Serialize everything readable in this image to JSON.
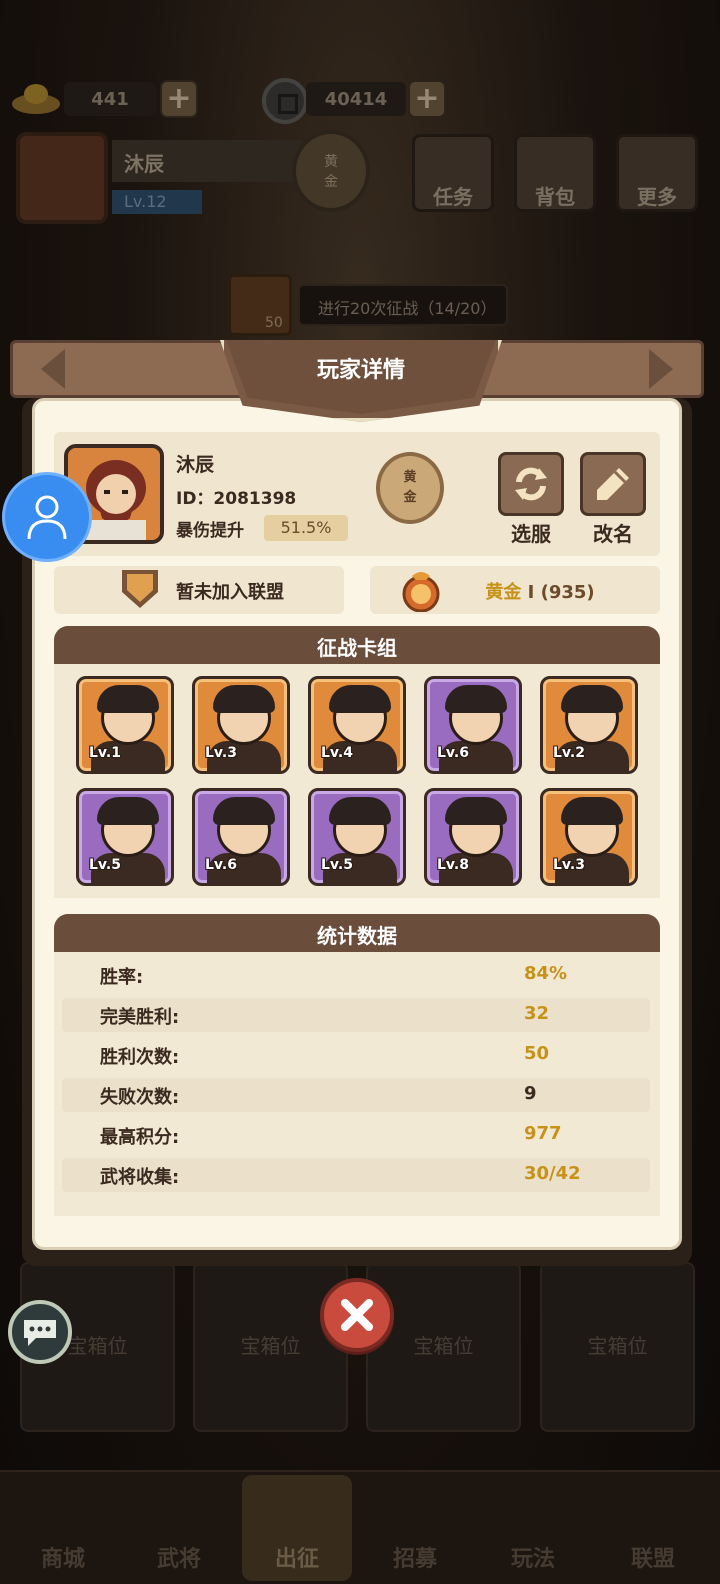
{
  "resources": {
    "ingot": "441",
    "coins": "40414"
  },
  "top_player": {
    "name": "沐辰",
    "level": "Lv.12",
    "rank_line1": "黄",
    "rank_line2": "金"
  },
  "top_buttons": {
    "tasks": "任务",
    "bag": "背包",
    "more": "更多"
  },
  "quest": {
    "reward": "50",
    "text": "进行20次征战（14/20）"
  },
  "modal": {
    "title": "玩家详情",
    "player": {
      "name": "沐辰",
      "id_text": "ID：2081398",
      "crit_label": "暴伤提升",
      "crit_value": "51.5%",
      "rank_line1": "黄",
      "rank_line2": "金"
    },
    "buttons": {
      "select_server": "选服",
      "rename": "改名"
    },
    "alliance_text": "暂未加入联盟",
    "rank_info": {
      "tier": "黄金",
      "detail": " Ⅰ (935)"
    },
    "deck_title": "征战卡组",
    "deck": [
      {
        "level": "Lv.1",
        "rarity": "orange"
      },
      {
        "level": "Lv.3",
        "rarity": "orange"
      },
      {
        "level": "Lv.4",
        "rarity": "orange"
      },
      {
        "level": "Lv.6",
        "rarity": "purple"
      },
      {
        "level": "Lv.2",
        "rarity": "orange"
      },
      {
        "level": "Lv.5",
        "rarity": "purple"
      },
      {
        "level": "Lv.6",
        "rarity": "purple"
      },
      {
        "level": "Lv.5",
        "rarity": "purple"
      },
      {
        "level": "Lv.8",
        "rarity": "purple"
      },
      {
        "level": "Lv.3",
        "rarity": "orange"
      }
    ],
    "stats_title": "统计数据",
    "stats": [
      {
        "label": "胜率:",
        "value": "84%",
        "highlight": true
      },
      {
        "label": "完美胜利:",
        "value": "32",
        "highlight": true
      },
      {
        "label": "胜利次数:",
        "value": "50",
        "highlight": true
      },
      {
        "label": "失败次数:",
        "value": "9",
        "highlight": false
      },
      {
        "label": "最高积分:",
        "value": "977",
        "highlight": true
      },
      {
        "label": "武将收集:",
        "value": "30/42",
        "highlight": true
      }
    ]
  },
  "chest_slots": [
    "宝箱位",
    "宝箱位",
    "宝箱位",
    "宝箱位"
  ],
  "nav": [
    "商城",
    "武将",
    "出征",
    "招募",
    "玩法",
    "联盟"
  ],
  "colors": {
    "highlight_value": "#c7921a",
    "panel_header": "#6b4d3b",
    "close_button": "#c94b3e"
  }
}
